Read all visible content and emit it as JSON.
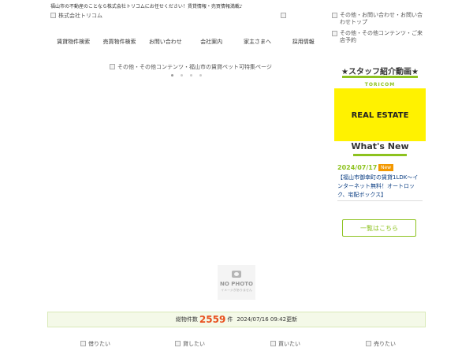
{
  "header": {
    "tagline": "福山市の不動産のことなら株式会社トリコムにお任せください！賃貸情報・売買情報満載♪",
    "logo_alt": "株式会社トリコム",
    "right_links": [
      {
        "alt": "その他・お問い合わせ・お問い合わせトップ"
      },
      {
        "alt": "その他・その他コンテンツ・ご来店予約"
      }
    ]
  },
  "nav": {
    "items": [
      "賃貸物件検索",
      "売買物件検索",
      "お問い合わせ",
      "会社案内",
      "家主さまへ",
      "採用情報"
    ]
  },
  "slider": {
    "image_alt": "その他・その他コンテンツ・福山市の賃貸ペット可特集ページ",
    "active_dot": 0
  },
  "sidebar": {
    "staff_title": "★スタッフ紹介動画★",
    "banner_small": "TORICOM",
    "banner_text": "REAL ESTATE",
    "whats_new_title": "What's New",
    "news": {
      "date": "2024/07/17",
      "badge": "New",
      "text": "【福山市御幸町の賃貸1LDK～インターネット無料！オートロック、宅配ボックス】"
    },
    "list_button": "一覧はこちら"
  },
  "no_photo": {
    "main": "NO PHOTO",
    "sub": "イメージがありません"
  },
  "stats": {
    "prefix": "総物件数",
    "count": "2559",
    "suffix": "件",
    "updated": "2024/07/16 09:42更新"
  },
  "bottom_links": [
    {
      "alt": "借りたい"
    },
    {
      "alt": "貸したい"
    },
    {
      "alt": "買いたい"
    },
    {
      "alt": "売りたい"
    }
  ],
  "colors": {
    "accent": "#8dc21f",
    "banner": "#fff200",
    "count": "#e8501e",
    "badge": "#f39800"
  }
}
